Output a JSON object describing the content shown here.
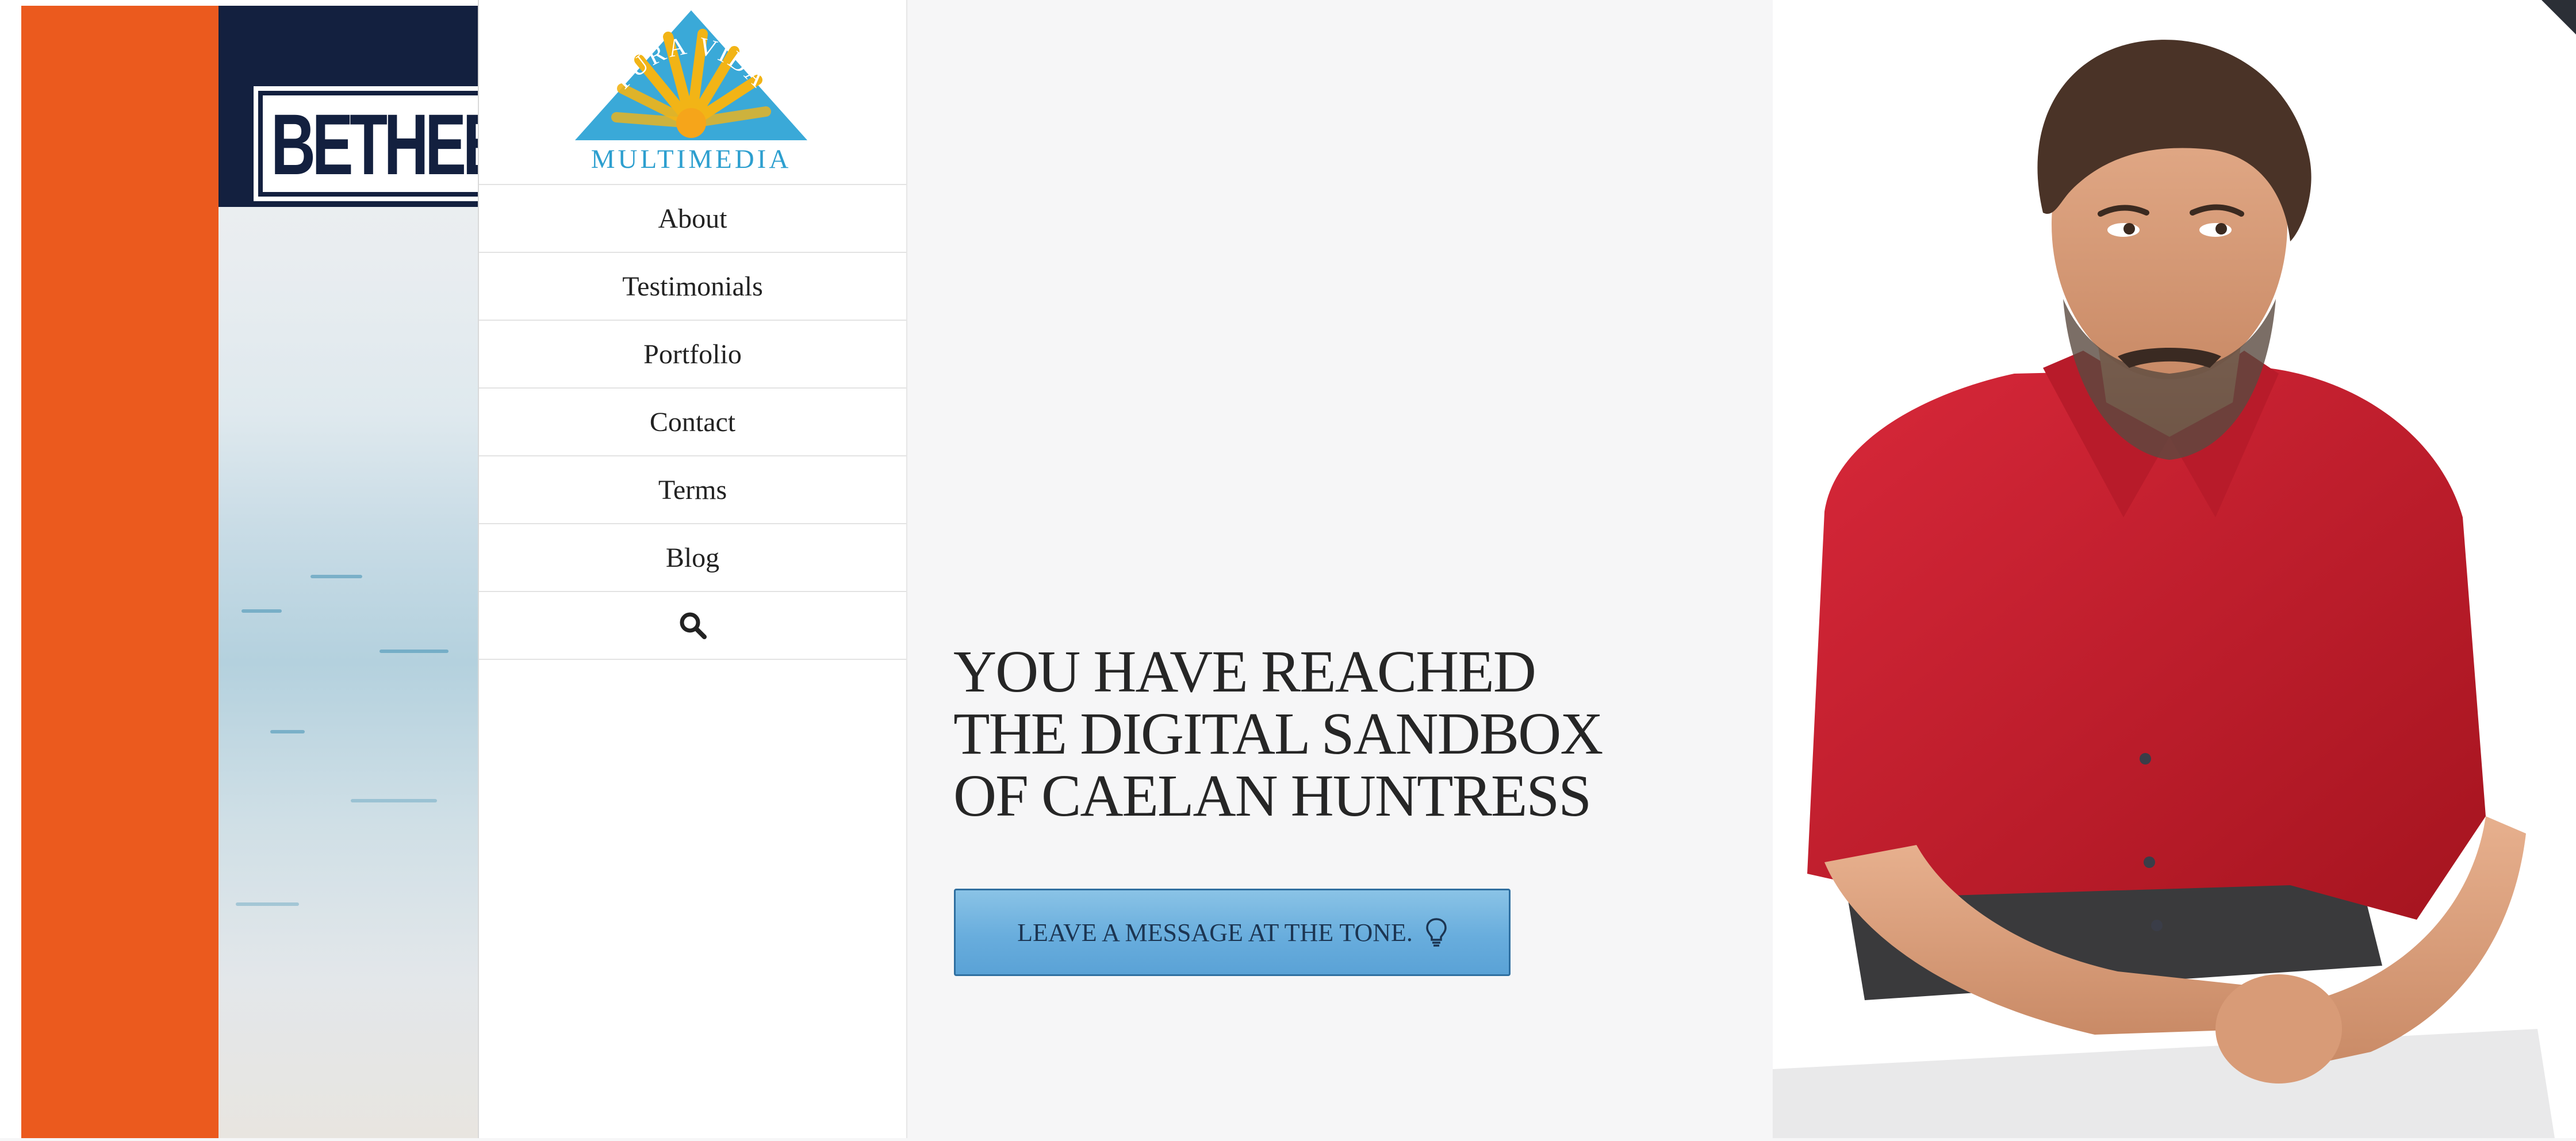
{
  "background_preview": {
    "banner_text": "BETHEBE"
  },
  "sidebar": {
    "logo": {
      "arc_text": "PURA VIDA",
      "word": "MULTIMEDIA"
    },
    "nav": [
      {
        "label": "About"
      },
      {
        "label": "Testimonials"
      },
      {
        "label": "Portfolio"
      },
      {
        "label": "Contact"
      },
      {
        "label": "Terms"
      },
      {
        "label": "Blog"
      }
    ],
    "search_icon": "search-icon"
  },
  "hero": {
    "headline_lines": [
      "YOU HAVE REACHED",
      "THE DIGITAL SANDBOX",
      "OF CAELAN HUNTRESS"
    ],
    "cta_label": "LEAVE A MESSAGE AT THE TONE.",
    "cta_icon": "lightbulb-icon"
  },
  "colors": {
    "accent_orange": "#eb5a1e",
    "navy": "#13203f",
    "logo_blue": "#2d9fcf",
    "logo_sun": "#f2b416",
    "button_blue": "#68addd",
    "shirt_red": "#c81e2c"
  }
}
